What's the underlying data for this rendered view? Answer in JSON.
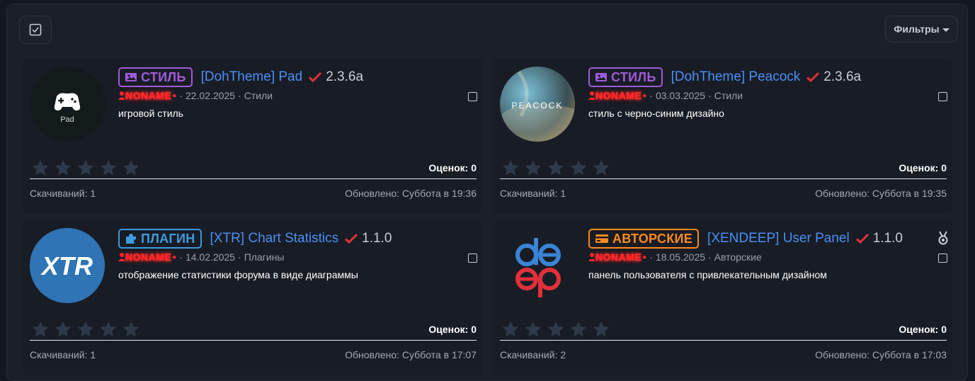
{
  "toolbar": {
    "filters_label": "Фильтры"
  },
  "cards": [
    {
      "badge": "СТИЛЬ",
      "title": "[DohTheme] Pad",
      "version": "2.3.6a",
      "author": "NONAME",
      "date": "22.02.2025",
      "category": "Стили",
      "description": "игровой стиль",
      "thumb_label": "Pad",
      "ratings": "Оценок: 0",
      "downloads": "Скачиваний:  1",
      "updated": "Обновлено:  Суббота в 19:36"
    },
    {
      "badge": "СТИЛЬ",
      "title": "[DohTheme] Peacock",
      "version": "2.3.6a",
      "author": "NONAME",
      "date": "03.03.2025",
      "category": "Стили",
      "description": "стиль с черно-синим дизайно",
      "thumb_label": "PEACOCK",
      "ratings": "Оценок: 0",
      "downloads": "Скачиваний:  1",
      "updated": "Обновлено:  Суббота в 19:35"
    },
    {
      "badge": "ПЛАГИН",
      "title": "[XTR] Chart Statistics",
      "version": "1.1.0",
      "author": "NONAME",
      "date": "14.02.2025",
      "category": "Плагины",
      "description": "отображение статистики форума в виде диаграммы",
      "thumb_label": "XTR",
      "ratings": "Оценок: 0",
      "downloads": "Скачиваний:  1",
      "updated": "Обновлено:  Суббота в 17:07"
    },
    {
      "badge": "АВТОРСКИЕ",
      "title": "[XENDEEP] User Panel",
      "version": "1.1.0",
      "author": "NONAME",
      "date": "18.05.2025",
      "category": "Авторские",
      "description": "панель пользователя с привлекательным дизайном",
      "thumb_label": "de ep",
      "ratings": "Оценок: 0",
      "downloads": "Скачиваний:  2",
      "updated": "Обновлено:  Суббота в 17:03"
    }
  ],
  "colors": {
    "style_badge": "#a05ad8",
    "plugin_badge": "#3d9be0",
    "author_badge": "#ff8a1e",
    "title_link": "#4b8ff5",
    "checkmark": "#e0303a",
    "star_empty": "#2e3a4a"
  },
  "icons": {
    "select_all": "checkbox-icon",
    "style_badge": "image-icon",
    "plugin_badge": "puzzle-icon",
    "author_badge": "credit-card-icon",
    "verified": "check-icon",
    "featured": "medal-icon",
    "author": "user-icon",
    "star": "star-icon"
  }
}
